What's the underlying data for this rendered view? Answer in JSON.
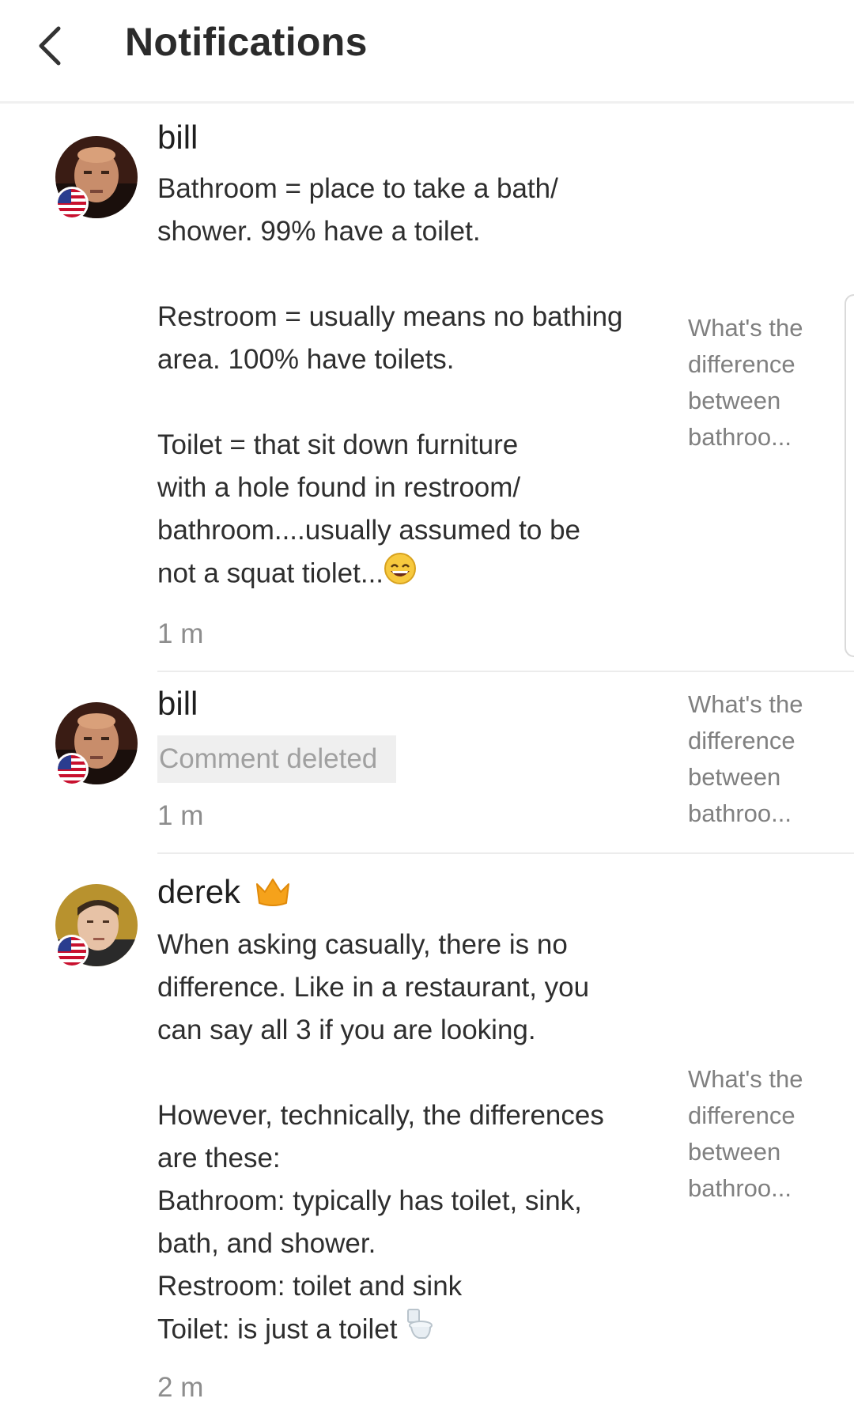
{
  "header": {
    "title": "Notifications"
  },
  "notifications": [
    {
      "username": "bill",
      "text": "Bathroom = place to take a bath/\nshower. 99% have a toilet.\n\nRestroom = usually means no bathing\narea.  100% have toilets.\n\nToilet = that sit down furniture\nwith a hole found in restroom/\nbathroom....usually assumed to be\nnot a squat tiolet...",
      "time": "1 m",
      "preview": "What's the difference between bathroo..."
    },
    {
      "username": "bill",
      "text": "Comment deleted",
      "time": "1 m",
      "preview": "What's the difference between bathroo..."
    },
    {
      "username": "derek",
      "text": "When asking casually, there is no\ndifference. Like in a restaurant, you\ncan say all 3 if you are looking.\n\nHowever, technically, the differences\nare these:\nBathroom: typically has toilet, sink,\nbath, and shower.\nRestroom: toilet and sink\nToilet: is just a toilet",
      "time": "2 m",
      "preview": "What's the difference between bathroo..."
    }
  ]
}
